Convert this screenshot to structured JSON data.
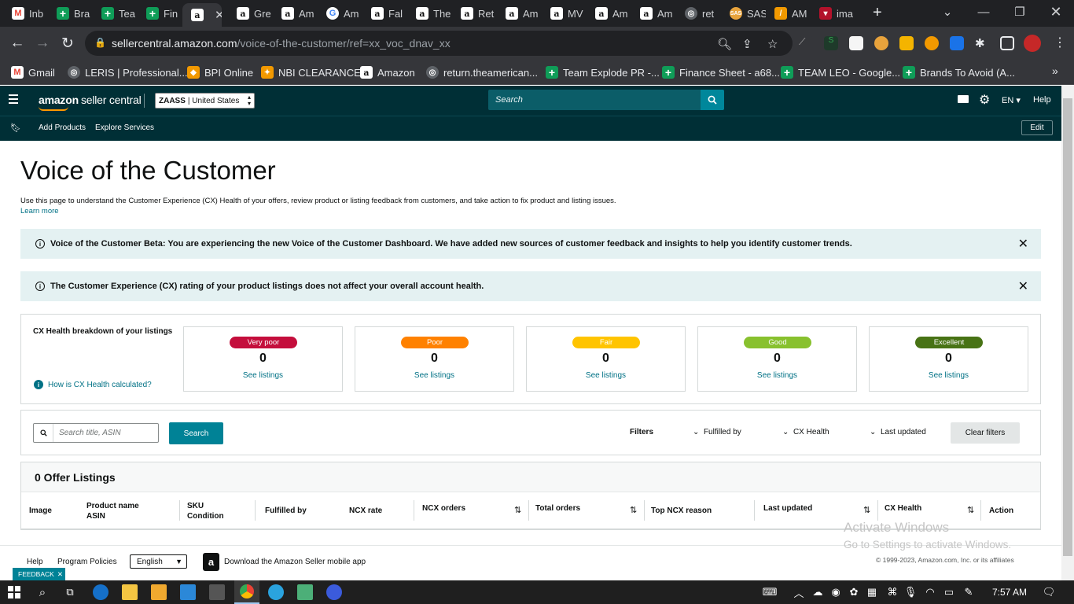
{
  "browser": {
    "tabs": [
      {
        "title": "Inb",
        "icon": "gmail-icon"
      },
      {
        "title": "Bra",
        "icon": "sheets-icon"
      },
      {
        "title": "Tea",
        "icon": "sheets-icon"
      },
      {
        "title": "Fin",
        "icon": "sheets-icon"
      },
      {
        "title": "",
        "icon": "amazon-icon",
        "active": true
      },
      {
        "title": "Gre",
        "icon": "amazon-icon"
      },
      {
        "title": "Am",
        "icon": "amazon-icon"
      },
      {
        "title": "Am",
        "icon": "google-icon"
      },
      {
        "title": "Fal",
        "icon": "amazon-icon"
      },
      {
        "title": "The",
        "icon": "amazon-icon"
      },
      {
        "title": "Ret",
        "icon": "amazon-icon"
      },
      {
        "title": "Am",
        "icon": "amazon-icon"
      },
      {
        "title": "MV",
        "icon": "amazon-icon"
      },
      {
        "title": "Am",
        "icon": "amazon-icon"
      },
      {
        "title": "Am",
        "icon": "amazon-icon"
      },
      {
        "title": "ret",
        "icon": "globe-icon"
      },
      {
        "title": "SAS",
        "icon": "sas-icon"
      },
      {
        "title": "AM",
        "icon": "pen-icon"
      },
      {
        "title": "ima",
        "icon": "red-icon"
      }
    ],
    "url_domain": "sellercentral.amazon.com",
    "url_path": "/voice-of-the-customer/ref=xx_voc_dnav_xx",
    "bookmarks": [
      "Gmail",
      "LERIS | Professional...",
      "BPI Online",
      "NBI CLEARANCE",
      "Amazon",
      "return.theamerican...",
      "Team Explode PR -...",
      "Finance Sheet - a68...",
      "TEAM LEO - Google...",
      "Brands To Avoid (A..."
    ]
  },
  "header": {
    "logo_main": "amazon",
    "logo_sub": "seller central",
    "store_bold": "ZAASS",
    "store_rest": "| United States",
    "search_placeholder": "Search",
    "language": "EN",
    "help": "Help",
    "nav": [
      "Add Products",
      "Explore Services"
    ],
    "edit": "Edit"
  },
  "page": {
    "title": "Voice of the Customer",
    "description": "Use this page to understand the Customer Experience (CX) Health of your offers, review product or listing feedback from customers, and take action to fix product and listing issues.",
    "learn_more": "Learn more",
    "banner1": "Voice of the Customer Beta: You are experiencing the new Voice of the Customer Dashboard. We have added new sources of customer feedback and insights to help you identify customer trends.",
    "banner2": "The Customer Experience (CX) rating of your product listings does not affect your overall account health."
  },
  "cx_health": {
    "title": "CX Health breakdown of your listings",
    "how_link": "How is CX Health calculated?",
    "cards": [
      {
        "label": "Very poor",
        "count": "0",
        "link": "See listings",
        "color": "#c40e3c"
      },
      {
        "label": "Poor",
        "count": "0",
        "link": "See listings",
        "color": "#ff8100"
      },
      {
        "label": "Fair",
        "count": "0",
        "link": "See listings",
        "color": "#ffc400"
      },
      {
        "label": "Good",
        "count": "0",
        "link": "See listings",
        "color": "#88c12e"
      },
      {
        "label": "Excellent",
        "count": "0",
        "link": "See listings",
        "color": "#487315"
      }
    ]
  },
  "filters": {
    "search_placeholder": "Search title, ASIN",
    "search_button": "Search",
    "label": "Filters",
    "fulfilled_by": "Fulfilled by",
    "cx_health": "CX Health",
    "last_updated": "Last updated",
    "clear": "Clear filters"
  },
  "listings": {
    "count_title": "0 Offer Listings",
    "columns": {
      "image": "Image",
      "product_name": "Product name",
      "asin": "ASIN",
      "sku": "SKU",
      "condition": "Condition",
      "fulfilled_by": "Fulfilled by",
      "ncx_rate": "NCX rate",
      "ncx_orders": "NCX orders",
      "total_orders": "Total orders",
      "top_ncx_reason": "Top NCX reason",
      "last_updated": "Last updated",
      "cx_health": "CX Health",
      "action": "Action"
    }
  },
  "footer": {
    "help": "Help",
    "program_policies": "Program Policies",
    "language": "English",
    "app_download": "Download the Amazon Seller mobile app",
    "copyright": "© 1999-2023, Amazon.com, Inc. or its affiliates",
    "feedback": "FEEDBACK",
    "watermark1": "Activate Windows",
    "watermark2": "Go to Settings to activate Windows."
  },
  "taskbar": {
    "time": "7:57 AM"
  }
}
